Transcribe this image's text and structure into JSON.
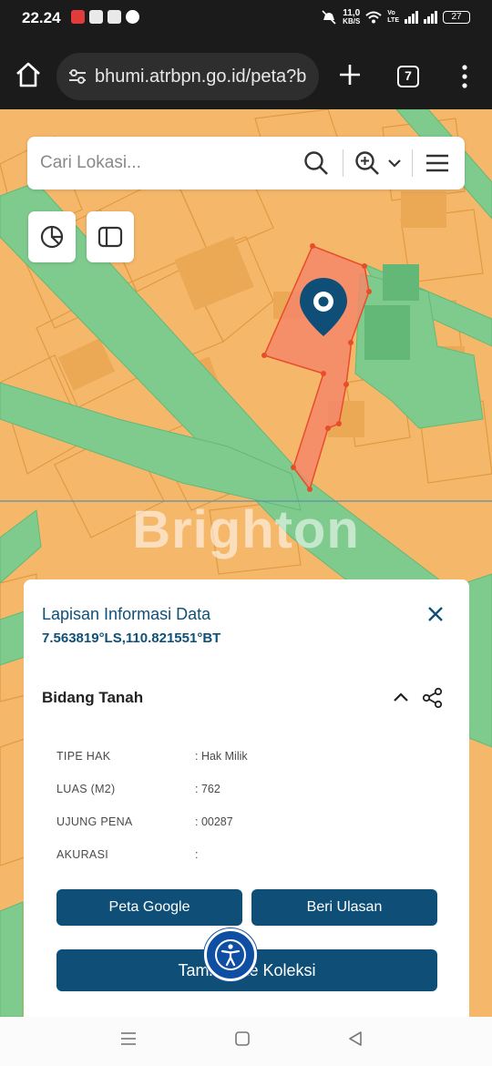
{
  "status_bar": {
    "time": "22.24",
    "speed_value": "11,0",
    "speed_unit": "KB/S",
    "lte_top": "Vo",
    "lte_bottom": "LTE",
    "battery": "27",
    "app_icons": [
      "shopee-icon",
      "instagram-icon",
      "gojek-icon",
      "messenger-icon"
    ]
  },
  "browser": {
    "url": "bhumi.atrbpn.go.id/peta?b",
    "tab_count": "7"
  },
  "map": {
    "search": {
      "placeholder": "Cari Lokasi..."
    },
    "watermark": "Brighton"
  },
  "info_panel": {
    "title": "Lapisan Informasi Data",
    "coordinates": "7.563819°LS,110.821551°BT",
    "section_title": "Bidang Tanah",
    "attributes": [
      {
        "label": "TIPE HAK",
        "value": ": Hak Milik"
      },
      {
        "label": "LUAS (M2)",
        "value": ": 762"
      },
      {
        "label": "UJUNG PENA",
        "value": ": 00287"
      },
      {
        "label": "AKURASI",
        "value": ":"
      }
    ],
    "buttons": {
      "google_map": "Peta Google",
      "review": "Beri Ulasan",
      "add_collection": "Tambah ke Koleksi"
    }
  },
  "colors": {
    "map_base": "#f5b86a",
    "road_green": "#7fcb8e",
    "parcel_fill": "#f4876a",
    "accent_blue": "#0f4f77"
  }
}
